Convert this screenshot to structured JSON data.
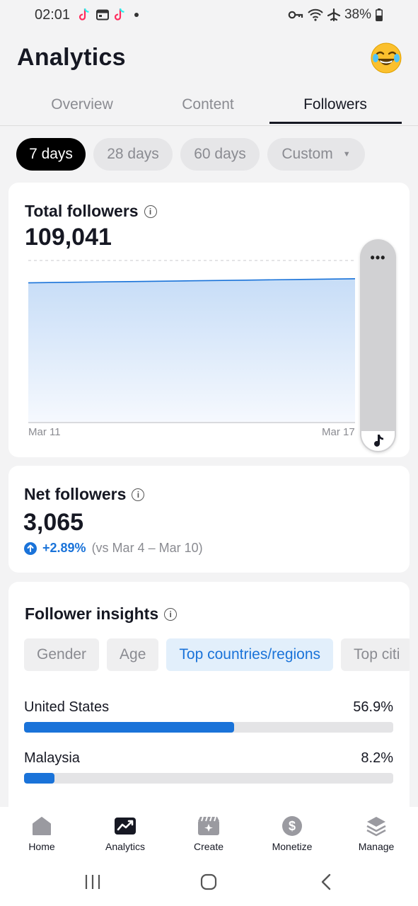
{
  "status_bar": {
    "time": "02:01",
    "battery": "38%"
  },
  "header": {
    "title": "Analytics",
    "avatar_icon": "laughing-emoji-icon"
  },
  "tabs": [
    {
      "label": "Overview",
      "active": false
    },
    {
      "label": "Content",
      "active": false
    },
    {
      "label": "Followers",
      "active": true
    }
  ],
  "date_filters": [
    {
      "label": "7 days",
      "active": true
    },
    {
      "label": "28 days",
      "active": false
    },
    {
      "label": "60 days",
      "active": false
    },
    {
      "label": "Custom",
      "active": false
    }
  ],
  "total_followers": {
    "title": "Total followers",
    "value": "109,041",
    "chart_data": {
      "type": "area",
      "x": [
        "Mar 11",
        "Mar 12",
        "Mar 13",
        "Mar 14",
        "Mar 15",
        "Mar 16",
        "Mar 17"
      ],
      "y": [
        105976,
        106480,
        106990,
        107500,
        108010,
        108520,
        109041
      ],
      "xlabel": "",
      "ylabel": "",
      "x_tick_labels": [
        "Mar 11",
        "Mar 17"
      ],
      "grid": true,
      "color": "#1a73d9"
    }
  },
  "net_followers": {
    "title": "Net followers",
    "value": "3,065",
    "delta": "+2.89%",
    "compare": "(vs Mar 4 – Mar 10)"
  },
  "follower_insights": {
    "title": "Follower insights",
    "chips": [
      {
        "label": "Gender",
        "active": false
      },
      {
        "label": "Age",
        "active": false
      },
      {
        "label": "Top countries/regions",
        "active": true
      },
      {
        "label": "Top citi",
        "active": false
      }
    ],
    "countries": [
      {
        "name": "United States",
        "percent": "56.9%",
        "fraction": 0.569
      },
      {
        "name": "Malaysia",
        "percent": "8.2%",
        "fraction": 0.082
      }
    ]
  },
  "bottom_nav": [
    {
      "label": "Home",
      "icon": "home-icon"
    },
    {
      "label": "Analytics",
      "icon": "analytics-icon"
    },
    {
      "label": "Create",
      "icon": "create-icon"
    },
    {
      "label": "Monetize",
      "icon": "dollar-icon"
    },
    {
      "label": "Manage",
      "icon": "layers-icon"
    }
  ],
  "colors": {
    "accent": "#1a73d9",
    "background": "#f3f3f4"
  }
}
